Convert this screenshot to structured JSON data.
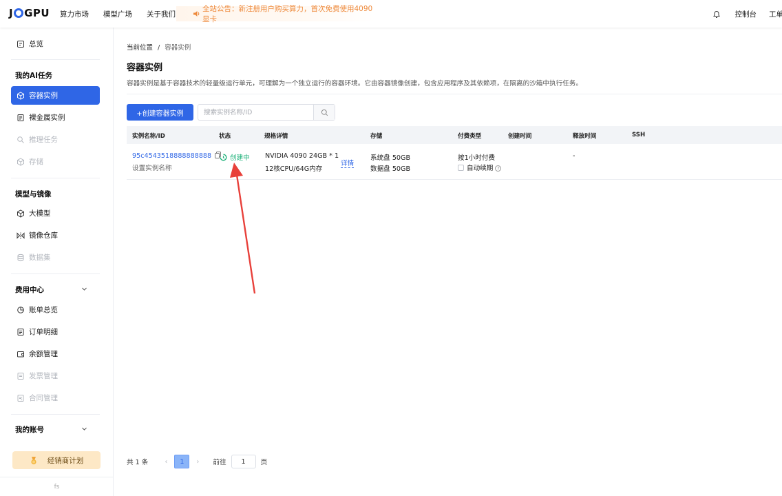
{
  "brand": {
    "logo_left": "J",
    "logo_right": "GPU",
    "accent": "#2f66e6"
  },
  "nav": {
    "items": [
      "算力市场",
      "模型广场",
      "关于我们"
    ]
  },
  "notice": {
    "text": "全站公告：新注册用户购买算力，首次免费使用4090显卡"
  },
  "top_right": {
    "console": "控制台",
    "tickets": "工单"
  },
  "sidebar": {
    "overview": "总览",
    "group_ai": "我的AI任务",
    "container": "容器实例",
    "baremetal": "裸金属实例",
    "inference": "推理任务",
    "storage": "存储",
    "group_models": "模型与镜像",
    "llm": "大模型",
    "images": "镜像仓库",
    "datasets": "数据集",
    "group_billing": "费用中心",
    "bills": "账单总览",
    "orders": "订单明细",
    "balance": "余额管理",
    "invoices": "发票管理",
    "contracts": "合同管理",
    "group_account": "我的账号",
    "promo": "经销商计划",
    "bottom": "fs"
  },
  "main": {
    "breadcrumb_root": "当前位置",
    "breadcrumb_sep": "/",
    "breadcrumb_current": "容器实例",
    "title": "容器实例",
    "description": "容器实例是基于容器技术的轻量级运行单元，可理解为一个独立运行的容器环境。它由容器镜像创建，包含应用程序及其依赖项，在隔离的沙箱中执行任务。",
    "create_button": "+创建容器实例",
    "search_placeholder": "搜索实例名称/ID"
  },
  "table": {
    "headers": {
      "name": "实例名称/ID",
      "status": "状态",
      "spec": "规格详情",
      "storage": "存储",
      "billing": "付费类型",
      "created": "创建时间",
      "released": "释放时间",
      "ssh": "SSH"
    },
    "rows": [
      {
        "id": "95c4543518888888888",
        "name_hint": "设置实例名称",
        "status": "创建中",
        "spec_line1": "NVIDIA 4090 24GB * 1",
        "spec_line2": "12核CPU/64G内存",
        "detail": "详情",
        "storage_sys": "系统盘 50GB",
        "storage_data": "数据盘 50GB",
        "billing": "按1小时付费",
        "auto_renew": "自动续期",
        "released": "-"
      }
    ]
  },
  "pagination": {
    "total": "共 1 条",
    "current_page": "1",
    "goto": "前往",
    "goto_value": "1",
    "page_unit": "页"
  },
  "annotation": {
    "color": "#e8403a"
  }
}
